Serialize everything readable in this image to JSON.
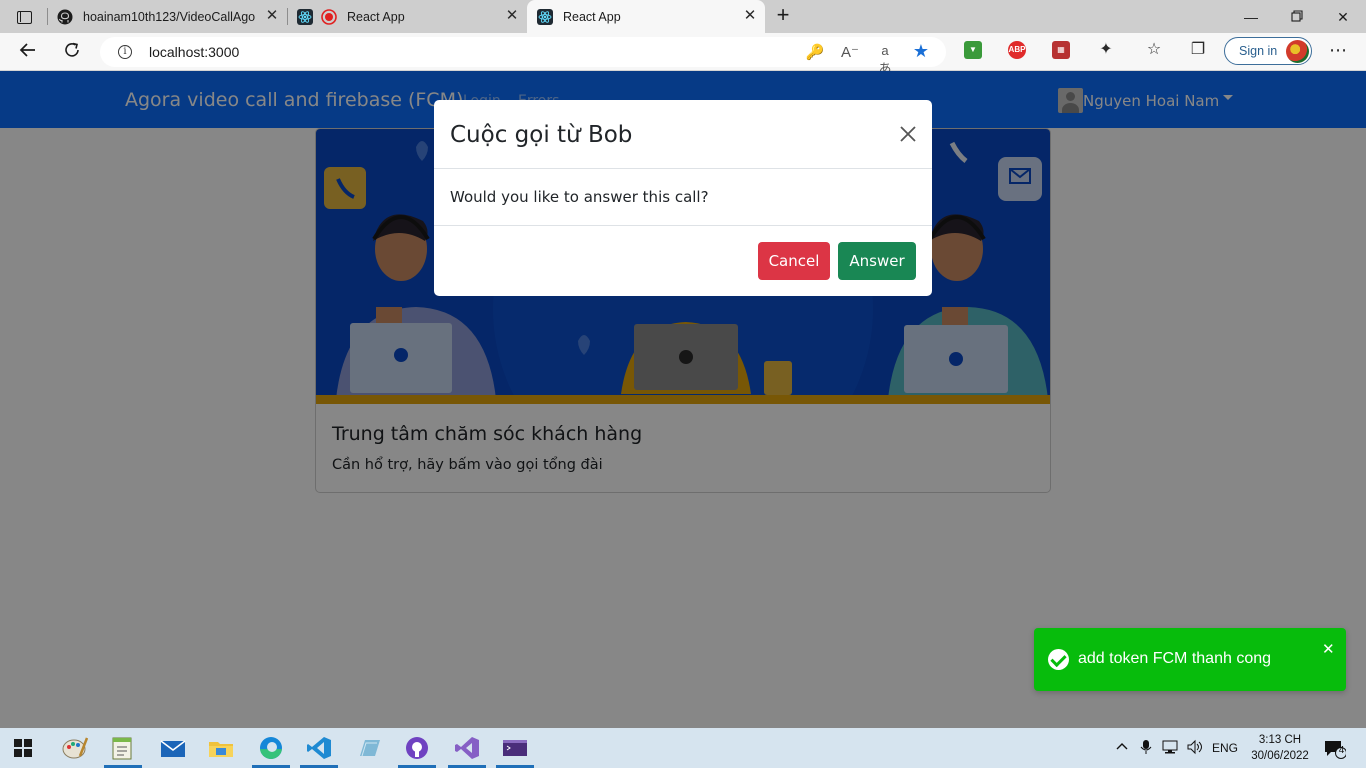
{
  "browser": {
    "tabs": [
      {
        "title": "hoainam10th123/VideoCallAgora",
        "icon": "github-icon"
      },
      {
        "title": "React App",
        "icon": "react-icon"
      },
      {
        "title": "React App",
        "icon": "react-icon",
        "active": true
      }
    ],
    "tab_close_glyph": "✕",
    "new_tab_glyph": "+",
    "url": "localhost:3000",
    "sign_in_label": "Sign in"
  },
  "app": {
    "brand": "Agora video call and firebase (FCM)",
    "nav_links": [
      "Login",
      "Errors"
    ],
    "user_name": "Nguyen Hoai Nam"
  },
  "card": {
    "title": "Trung tâm chăm sóc khách hàng",
    "text": "Cần hổ trợ, hãy bấm vào gọi tổng đài"
  },
  "modal": {
    "title": "Cuộc gọi từ Bob",
    "body": "Would you like to answer this call?",
    "cancel_label": "Cancel",
    "answer_label": "Answer"
  },
  "toast": {
    "message": "add token FCM thanh cong",
    "close_glyph": "✕"
  },
  "taskbar": {
    "language": "ENG",
    "time": "3:13 CH",
    "date": "30/06/2022",
    "notification_count": "4"
  },
  "colors": {
    "navbar": "#0d6efd",
    "danger": "#dc3545",
    "success": "#198754",
    "toast": "#07bc0c"
  }
}
